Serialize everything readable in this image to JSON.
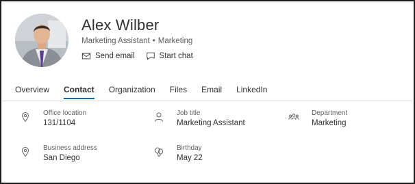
{
  "profile": {
    "name": "Alex Wilber",
    "title": "Marketing Assistant",
    "department": "Marketing",
    "separator": "•"
  },
  "actions": {
    "send_email": "Send email",
    "start_chat": "Start chat"
  },
  "tabs": [
    {
      "label": "Overview",
      "active": false
    },
    {
      "label": "Contact",
      "active": true
    },
    {
      "label": "Organization",
      "active": false
    },
    {
      "label": "Files",
      "active": false
    },
    {
      "label": "Email",
      "active": false
    },
    {
      "label": "LinkedIn",
      "active": false
    }
  ],
  "fields": {
    "office_location": {
      "label": "Office location",
      "value": "131/1104",
      "icon": "location-pin-icon"
    },
    "job_title": {
      "label": "Job title",
      "value": "Marketing Assistant",
      "icon": "person-icon"
    },
    "department": {
      "label": "Department",
      "value": "Marketing",
      "icon": "people-team-icon"
    },
    "business_address": {
      "label": "Business address",
      "value": "San Diego",
      "icon": "location-pin-icon"
    },
    "birthday": {
      "label": "Birthday",
      "value": "May 22",
      "icon": "balloon-icon"
    }
  },
  "colors": {
    "accent": "#0f6cbd",
    "text": "#323130",
    "secondary_text": "#605e5c",
    "border": "#1b1b1b"
  }
}
